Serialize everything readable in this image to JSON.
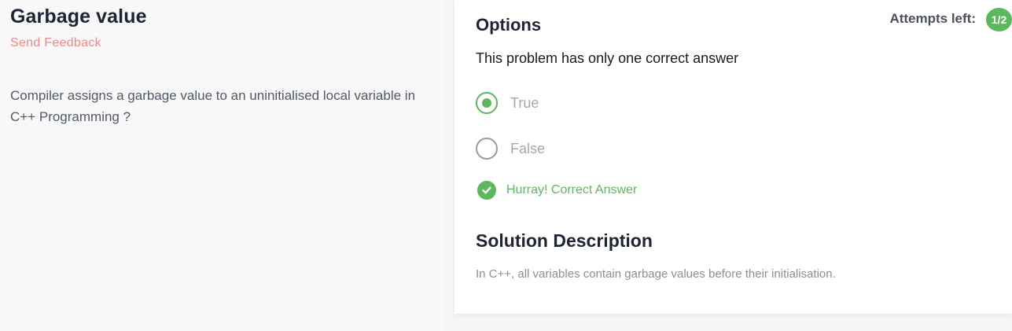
{
  "question": {
    "title": "Garbage value",
    "feedback_link": "Send Feedback",
    "text": "Compiler assigns a garbage value to an uninitialised local variable in C++ Programming ?"
  },
  "options_panel": {
    "heading": "Options",
    "attempts_label": "Attempts left:",
    "attempts_value": "1/2",
    "note": "This problem has only one correct answer",
    "options": [
      {
        "label": "True",
        "selected": true
      },
      {
        "label": "False",
        "selected": false
      }
    ],
    "result_text": "Hurray! Correct Answer",
    "solution_heading": "Solution Description",
    "solution_text": "In C++, all variables contain garbage values before their initialisation."
  },
  "colors": {
    "success": "#5cb85c",
    "feedback": "#f08a8a",
    "heading": "#1e2433"
  },
  "icons": [
    "radio-selected-icon",
    "radio-empty-icon",
    "check-circle-icon"
  ]
}
